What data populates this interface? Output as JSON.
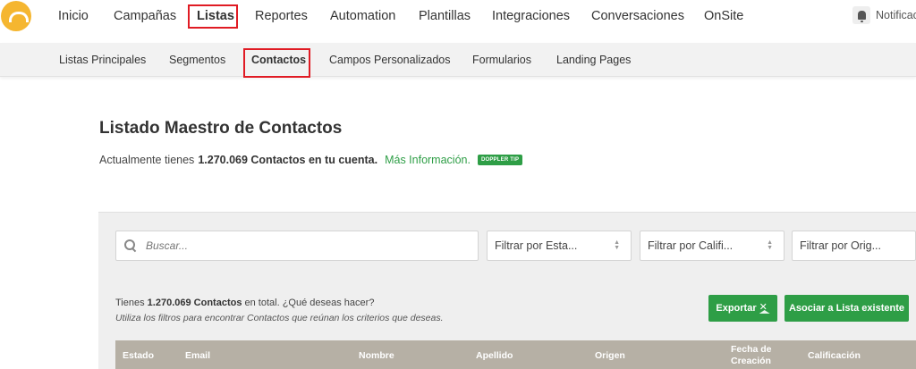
{
  "nav": {
    "items": [
      "Inicio",
      "Campañas",
      "Listas",
      "Reportes",
      "Automation",
      "Plantillas",
      "Integraciones",
      "Conversaciones",
      "OnSite"
    ],
    "active": "Listas",
    "notifications_label": "Notificac"
  },
  "subnav": {
    "items": [
      "Listas Principales",
      "Segmentos",
      "Contactos",
      "Campos Personalizados",
      "Formularios",
      "Landing Pages"
    ],
    "active": "Contactos"
  },
  "header": {
    "title": "Listado Maestro de Contactos",
    "subtitle_prefix": "Actualmente tienes",
    "subtitle_bold": "1.270.069 Contactos en tu cuenta.",
    "more_info": "Más Información.",
    "tip_badge": "DOPPLER TIP"
  },
  "filters": {
    "search_placeholder": "Buscar...",
    "status": "Filtrar por Esta...",
    "rating": "Filtrar por Califi...",
    "origin": "Filtrar por Orig..."
  },
  "summary": {
    "prefix": "Tienes",
    "bold": "1.270.069 Contactos",
    "suffix": "en total. ¿Qué deseas hacer?",
    "hint": "Utiliza los filtros para encontrar Contactos que reúnan los criterios que deseas."
  },
  "actions": {
    "export": "Exportar",
    "assign": "Asociar a Lista existente"
  },
  "table": {
    "columns": [
      "Estado",
      "Email",
      "Nombre",
      "Apellido",
      "Origen",
      "Fecha de",
      "Creación",
      "Calificación"
    ]
  },
  "colors": {
    "accent_green": "#2e9e46",
    "logo_yellow": "#f5b630",
    "highlight_red": "#e01b24",
    "table_header": "#b6b0a5"
  },
  "icons": [
    "logo-icon",
    "bell-icon",
    "search-icon",
    "chevron-updown-icon",
    "excel-icon"
  ]
}
